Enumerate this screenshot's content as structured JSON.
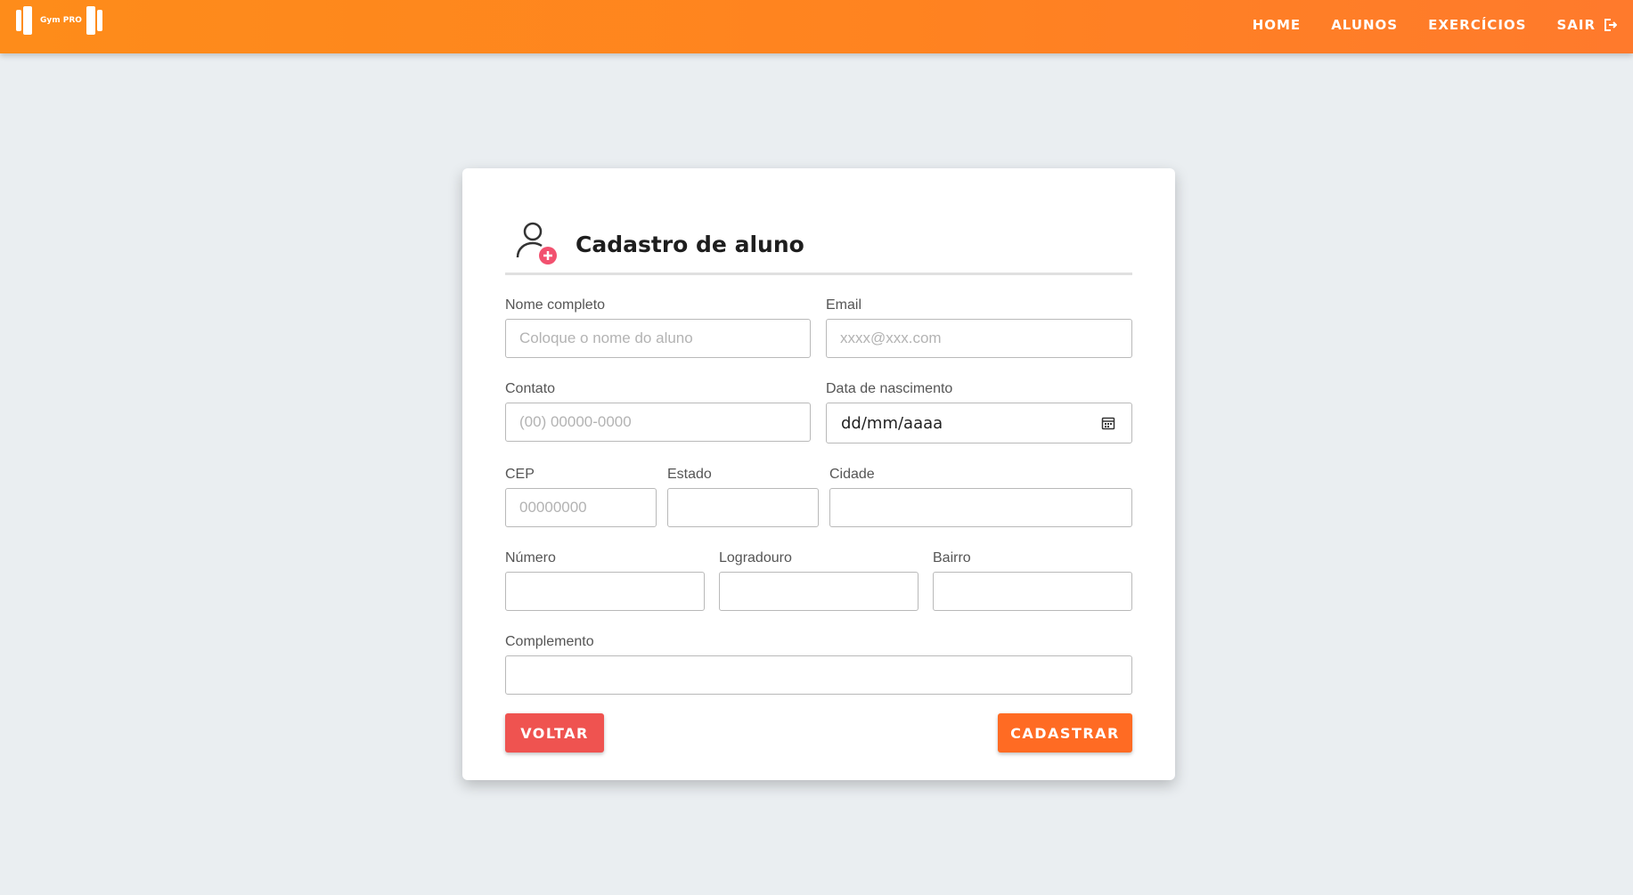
{
  "brand": {
    "name": "Gym PRO"
  },
  "nav": {
    "items": [
      {
        "label": "HOME"
      },
      {
        "label": "ALUNOS"
      },
      {
        "label": "EXERCÍCIOS"
      },
      {
        "label": "SAIR",
        "icon": "logout-icon"
      }
    ]
  },
  "form": {
    "title": "Cadastro de aluno",
    "icon": "add-user-icon",
    "fields": {
      "nome": {
        "label": "Nome completo",
        "placeholder": "Coloque o nome do aluno",
        "value": ""
      },
      "email": {
        "label": "Email",
        "placeholder": "xxxx@xxx.com",
        "value": ""
      },
      "contato": {
        "label": "Contato",
        "placeholder": "(00) 00000-0000",
        "value": ""
      },
      "nascimento": {
        "label": "Data de nascimento",
        "value": "dd/mm/aaaa",
        "icon": "calendar-icon"
      },
      "cep": {
        "label": "CEP",
        "placeholder": "00000000",
        "value": ""
      },
      "estado": {
        "label": "Estado",
        "placeholder": "",
        "value": ""
      },
      "cidade": {
        "label": "Cidade",
        "placeholder": "",
        "value": ""
      },
      "numero": {
        "label": "Número",
        "placeholder": "",
        "value": ""
      },
      "logradouro": {
        "label": "Logradouro",
        "placeholder": "",
        "value": ""
      },
      "bairro": {
        "label": "Bairro",
        "placeholder": "",
        "value": ""
      },
      "complemento": {
        "label": "Complemento",
        "placeholder": "",
        "value": ""
      }
    },
    "buttons": {
      "back": "VOLTAR",
      "submit": "CADASTRAR"
    }
  },
  "colors": {
    "navbar": "#ff8320",
    "background": "#eaeef1",
    "back_button": "#ef5350",
    "submit_button": "#ff6b23",
    "icon_accent": "#f2516f"
  }
}
